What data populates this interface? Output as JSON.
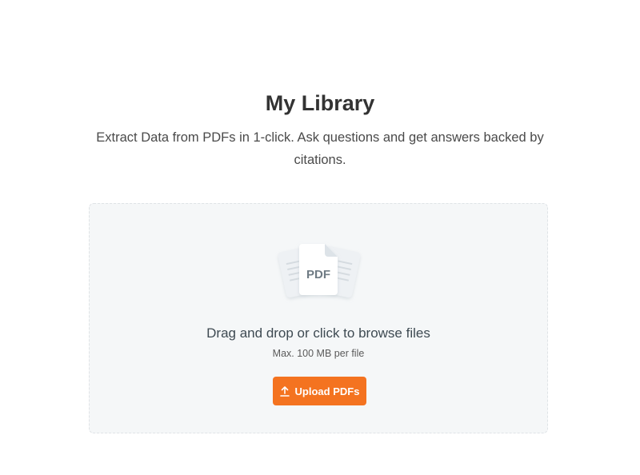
{
  "header": {
    "title": "My Library",
    "subtitle": "Extract Data from PDFs in 1-click. Ask questions and get answers backed by citations."
  },
  "dropzone": {
    "illustration_icon": "pdf-files-icon",
    "illustration_label": "PDF",
    "instruction": "Drag and drop or click to browse files",
    "size_limit": "Max. 100 MB per file",
    "upload_button_label": "Upload PDFs",
    "upload_button_icon": "upload-icon"
  },
  "colors": {
    "accent": "#f47320",
    "dropzone_background": "#f5f7f8",
    "title": "#333333"
  }
}
